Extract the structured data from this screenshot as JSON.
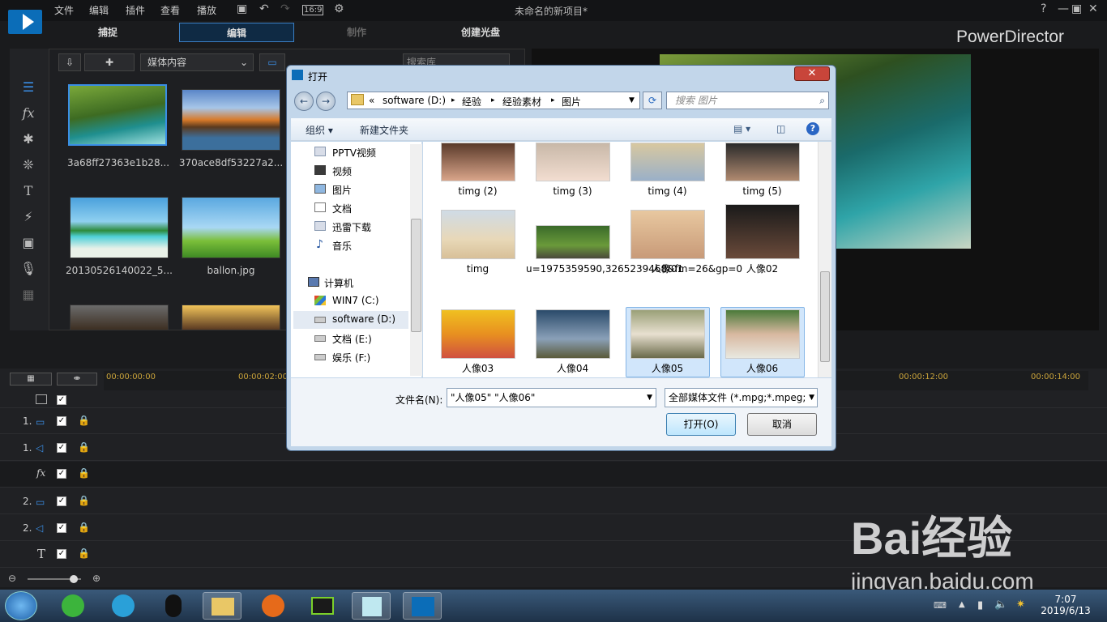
{
  "menubar": {
    "items": [
      "文件",
      "编辑",
      "插件",
      "查看",
      "播放"
    ],
    "aspect": "16:9",
    "project_title": "未命名的新项目*",
    "brand": "PowerDirector"
  },
  "modes": [
    "捕捉",
    "编辑",
    "制作",
    "创建光盘"
  ],
  "library": {
    "content_dropdown": "媒体内容",
    "search_placeholder": "搜索库",
    "items": [
      {
        "name": "3a68ff27363e1b28..."
      },
      {
        "name": "370ace8df53227a2..."
      },
      {
        "name": "20130526140022_5..."
      },
      {
        "name": "ballon.jpg"
      }
    ]
  },
  "timeline": {
    "ticks": [
      "00:00:00:00",
      "00:00:02:00",
      "00:00:12:00",
      "00:00:14:00"
    ],
    "tracks": [
      "1.",
      "1.",
      "fx",
      "2.",
      "2.",
      "T"
    ]
  },
  "dialog": {
    "title": "打开",
    "breadcrumb": [
      "«",
      "software (D:)",
      "经验",
      "经验素材",
      "图片"
    ],
    "search_placeholder": "搜索 图片",
    "toolbar": {
      "organize": "组织 ▾",
      "new_folder": "新建文件夹"
    },
    "nav": [
      "PPTV视频",
      "视频",
      "图片",
      "文档",
      "迅雷下载",
      "音乐",
      "计算机",
      "WIN7 (C:)",
      "software (D:)",
      "文档 (E:)",
      "娱乐 (F:)"
    ],
    "files": [
      {
        "name": "timg (2)"
      },
      {
        "name": "timg (3)"
      },
      {
        "name": "timg (4)"
      },
      {
        "name": "timg (5)"
      },
      {
        "name": "timg"
      },
      {
        "name": "u=1975359590,3265239468&fm=26&gp=0"
      },
      {
        "name": "人像01"
      },
      {
        "name": "人像02"
      },
      {
        "name": "人像03"
      },
      {
        "name": "人像04"
      },
      {
        "name": "人像05"
      },
      {
        "name": "人像06"
      }
    ],
    "filename_label": "文件名(N):",
    "filename_value": "\"人像05\" \"人像06\"",
    "filetype": "全部媒体文件 (*.mpg;*.mpeg;",
    "open_button": "打开(O)",
    "cancel_button": "取消"
  },
  "taskbar": {
    "time": "7:07",
    "date": "2019/6/13"
  },
  "watermark": {
    "text": "Bai经验",
    "url": "jingyan.baidu.com"
  }
}
